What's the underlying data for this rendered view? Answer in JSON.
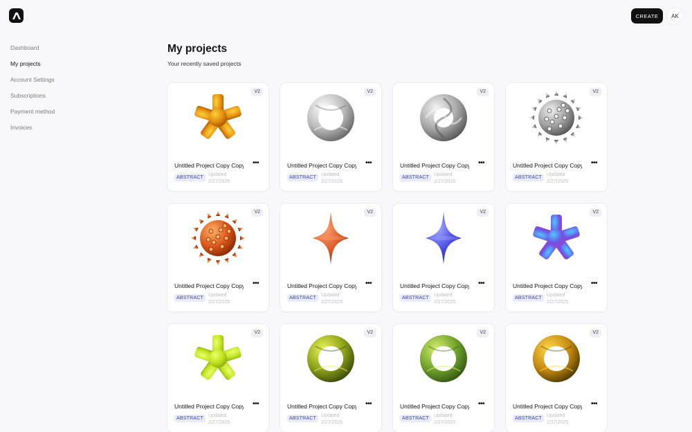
{
  "header": {
    "create_label": "CREATE",
    "avatar_initials": "AK"
  },
  "sidebar": {
    "items": [
      {
        "label": "Dashboard",
        "active": false
      },
      {
        "label": "My projects",
        "active": true
      },
      {
        "label": "Account Settings",
        "active": false
      },
      {
        "label": "Subscriptions",
        "active": false
      },
      {
        "label": "Payment method",
        "active": false
      },
      {
        "label": "Invoices",
        "active": false
      }
    ]
  },
  "main": {
    "title": "My projects",
    "subtitle": "Your recently saved projects"
  },
  "projects": [
    {
      "title": "Untitled Project Copy Copy Copy",
      "version": "V2",
      "tag": "ABSTRACT",
      "updated_label": "Updated",
      "updated_date": "2/27/2025",
      "shape": "asterisk-icon",
      "colors": [
        "#fbd23a",
        "#e48c0e",
        "#9a4f00"
      ]
    },
    {
      "title": "Untitled Project Copy Copy Copy",
      "version": "V2",
      "tag": "ABSTRACT",
      "updated_label": "Updated",
      "updated_date": "2/27/2025",
      "shape": "torus-icon",
      "colors": [
        "#ffffff",
        "#b9b9b9",
        "#5a5a5a"
      ]
    },
    {
      "title": "Untitled Project Copy Copy Copy",
      "version": "V2",
      "tag": "ABSTRACT",
      "updated_label": "Updated",
      "updated_date": "2/27/2025",
      "shape": "knot-icon",
      "colors": [
        "#f4f4f4",
        "#a8a8a8",
        "#4a4a4a"
      ]
    },
    {
      "title": "Untitled Project Copy Copy Copy",
      "version": "V2",
      "tag": "ABSTRACT",
      "updated_label": "Updated",
      "updated_date": "2/27/2025",
      "shape": "spiky-ball-icon",
      "colors": [
        "#f0f0f0",
        "#9f9f9f",
        "#474747"
      ]
    },
    {
      "title": "Untitled Project Copy Copy Copy",
      "version": "V2",
      "tag": "ABSTRACT",
      "updated_label": "Updated",
      "updated_date": "2/27/2025",
      "shape": "spiky-ball-icon",
      "colors": [
        "#ffb066",
        "#d9561a",
        "#7a2200"
      ]
    },
    {
      "title": "Untitled Project Copy Copy Copy",
      "version": "V2",
      "tag": "ABSTRACT",
      "updated_label": "Updated",
      "updated_date": "2/27/2025",
      "shape": "spinning-top-icon",
      "colors": [
        "#ffa070",
        "#dc5d2c",
        "#8a2a10"
      ]
    },
    {
      "title": "Untitled Project Copy Copy Copy",
      "version": "V2",
      "tag": "ABSTRACT",
      "updated_label": "Updated",
      "updated_date": "2/27/2025",
      "shape": "spinning-top-icon",
      "colors": [
        "#a6a9ff",
        "#4a4ce0",
        "#1d1e8a"
      ]
    },
    {
      "title": "Untitled Project Copy Copy Copy",
      "version": "V2",
      "tag": "ABSTRACT",
      "updated_label": "Updated",
      "updated_date": "2/27/2025",
      "shape": "asterisk-icon",
      "colors": [
        "#4fc8ff",
        "#6b56e6",
        "#a83ac9"
      ]
    },
    {
      "title": "Untitled Project Copy Copy Copy",
      "version": "V2",
      "tag": "ABSTRACT",
      "updated_label": "Updated",
      "updated_date": "2/27/2025",
      "shape": "asterisk-icon",
      "colors": [
        "#eaff6a",
        "#bfe21e",
        "#7fa50c"
      ]
    },
    {
      "title": "Untitled Project Copy Copy Copy",
      "version": "V2",
      "tag": "ABSTRACT",
      "updated_label": "Updated",
      "updated_date": "2/27/2025",
      "shape": "torus-icon",
      "colors": [
        "#e8f35a",
        "#8ea11a",
        "#2c3d06"
      ]
    },
    {
      "title": "Untitled Project Copy Copy Copy",
      "version": "V2",
      "tag": "ABSTRACT",
      "updated_label": "Updated",
      "updated_date": "2/27/2025",
      "shape": "torus-icon",
      "colors": [
        "#d6ef6e",
        "#6fa22a",
        "#2a4a10"
      ]
    },
    {
      "title": "Untitled Project Copy Copy Copy",
      "version": "V2",
      "tag": "ABSTRACT",
      "updated_label": "Updated",
      "updated_date": "2/27/2025",
      "shape": "torus-icon",
      "colors": [
        "#ffd84a",
        "#c48a10",
        "#3f2e00"
      ]
    }
  ]
}
